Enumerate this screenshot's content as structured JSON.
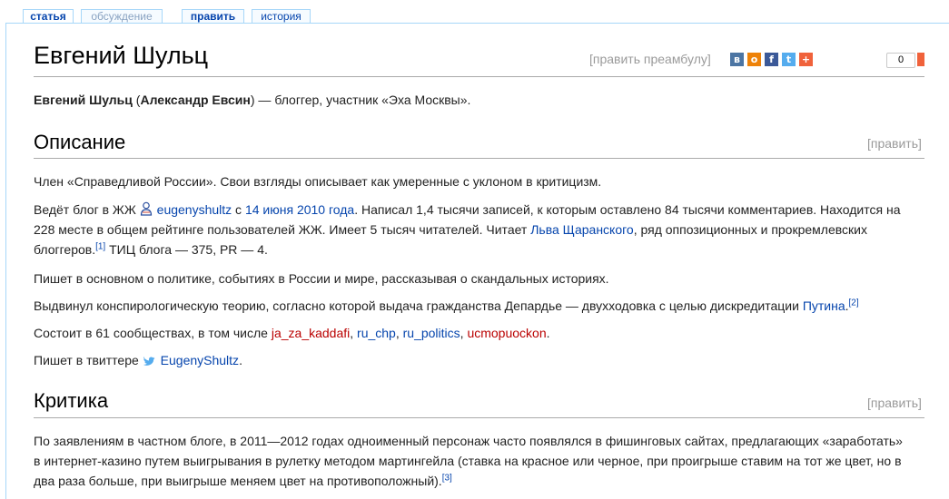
{
  "tabs": {
    "article": "статья",
    "discussion": "обсуждение",
    "edit": "править",
    "history": "история"
  },
  "page": {
    "title": "Евгений Шульц",
    "edit_preamble": "[править преамбулу]",
    "share_count": "0"
  },
  "intro": {
    "name_bold": "Евгений Шульц",
    "open_paren": " (",
    "alias_bold": "Александр Евсин",
    "rest": ") — блоггер, участник «Эха Москвы»."
  },
  "section_description": {
    "heading": "Описание",
    "edit": "[править]",
    "p1": "Член «Справедливой России». Свои взгляды описывает как умеренные с уклоном в критицизм.",
    "p2_a": "Ведёт блог в ЖЖ ",
    "p2_user": "eugenyshultz",
    "p2_b": " с ",
    "p2_date": "14 июня 2010 года",
    "p2_c": ". Написал 1,4 тысячи записей, к которым оставлено 84 тысячи комментариев. Находится на 228 месте в общем рейтинге пользователей ЖЖ. Имеет 5 тысяч читателей. Читает ",
    "p2_person": "Льва Щаранского",
    "p2_d": ", ряд оппозиционных и прокремлевских блоггеров.",
    "p2_ref": "[1]",
    "p2_e": " ТИЦ блога — 375, PR — 4.",
    "p3": "Пишет в основном о политике, событиях в России и мире, рассказывая о скандальных историях.",
    "p4_a": "Выдвинул конспирологическую теорию, согласно которой выдача гражданства Депардье — двухходовка с целью дискредитации ",
    "p4_link": "Путина",
    "p4_b": ".",
    "p4_ref": "[2]",
    "p5_a": "Состоит в 61 сообществах, в том числе ",
    "p5_c1": "ja_za_kaddafi",
    "p5_sep1": ", ",
    "p5_c2": "ru_chp",
    "p5_sep2": ", ",
    "p5_c3": "ru_politics",
    "p5_sep3": ", ",
    "p5_c4": "ucmopuockon",
    "p5_b": ".",
    "p6_a": "Пишет в твиттере ",
    "p6_link": "EugenyShultz",
    "p6_b": "."
  },
  "section_criticism": {
    "heading": "Критика",
    "edit": "[править]",
    "p1": "По заявлениям в частном блоге, в 2011—2012 годах одноименный персонаж часто появлялся в фишинговых сайтах, предлагающих «заработать» в интернет-казино путем выигрывания в рулетку методом мартингейла (ставка на красное или черное, при проигрыше ставим на тот же цвет, но в два раза больше, при выигрыше меняем цвет на противоположный).",
    "p1_ref": "[3]"
  },
  "icons": {
    "share_buttons": [
      "vk-icon",
      "odnoklassniki-icon",
      "facebook-icon",
      "twitter-icon",
      "more-share-icon"
    ],
    "colors": {
      "vk": "#4c75a3",
      "ok": "#ee8208",
      "fb": "#3b5998",
      "tw": "#55acee",
      "plus": "#f0623b"
    }
  }
}
